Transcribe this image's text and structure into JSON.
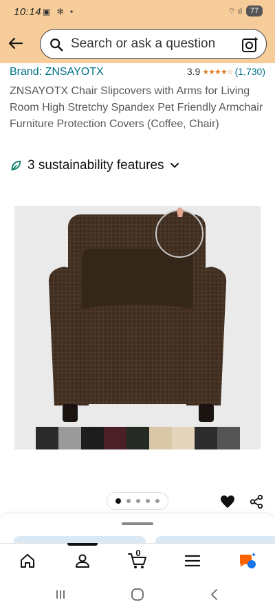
{
  "status_bar": {
    "time": "10:14",
    "left_icons": "▣ ✻ •",
    "signal": "⌔ ıl",
    "battery": "77"
  },
  "header": {
    "search_placeholder": "Search or ask a question"
  },
  "product": {
    "brand": "Brand: ZNSAYOTX",
    "rating": "3.9",
    "rating_stars": "★★★★☆",
    "rating_value": 3.9,
    "rating_count": "(1,730)",
    "title": "ZNSAYOTX Chair Slipcovers with Arms for Living Room High Stretchy Spandex Pet Friendly Armchair Furniture Protection Covers (Coffee, Chair)",
    "sustainability": "3 sustainability features"
  },
  "gallery": {
    "image_count": 5,
    "active_index": 0,
    "swatch_colors": [
      "#2a2a2a",
      "#9a9a9a",
      "#1d1d1d",
      "#4a1f25",
      "#262a25",
      "#d9c8a8",
      "#e4d6bd",
      "#2c2c2c",
      "#555555"
    ]
  },
  "colors": {
    "header_bg": "#f6cd9a",
    "link": "#007185",
    "star": "#de7921",
    "chair": "#3b2a1d"
  },
  "nav": {
    "cart_count": "0",
    "items": [
      "home-icon",
      "account-icon",
      "cart-icon",
      "menu-icon",
      "rufus-icon"
    ]
  }
}
